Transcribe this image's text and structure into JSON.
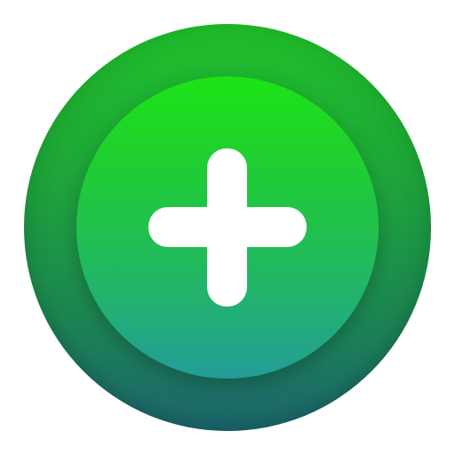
{
  "app_icon": {
    "name": "plus-badge",
    "icon": "plus-icon",
    "colors": {
      "outer_top": "#1fbf2a",
      "outer_bottom": "#1d6a72",
      "inner_top": "#1ce416",
      "inner_bottom": "#239c98",
      "plus": "#ffffff",
      "background": "#ffffff"
    }
  }
}
